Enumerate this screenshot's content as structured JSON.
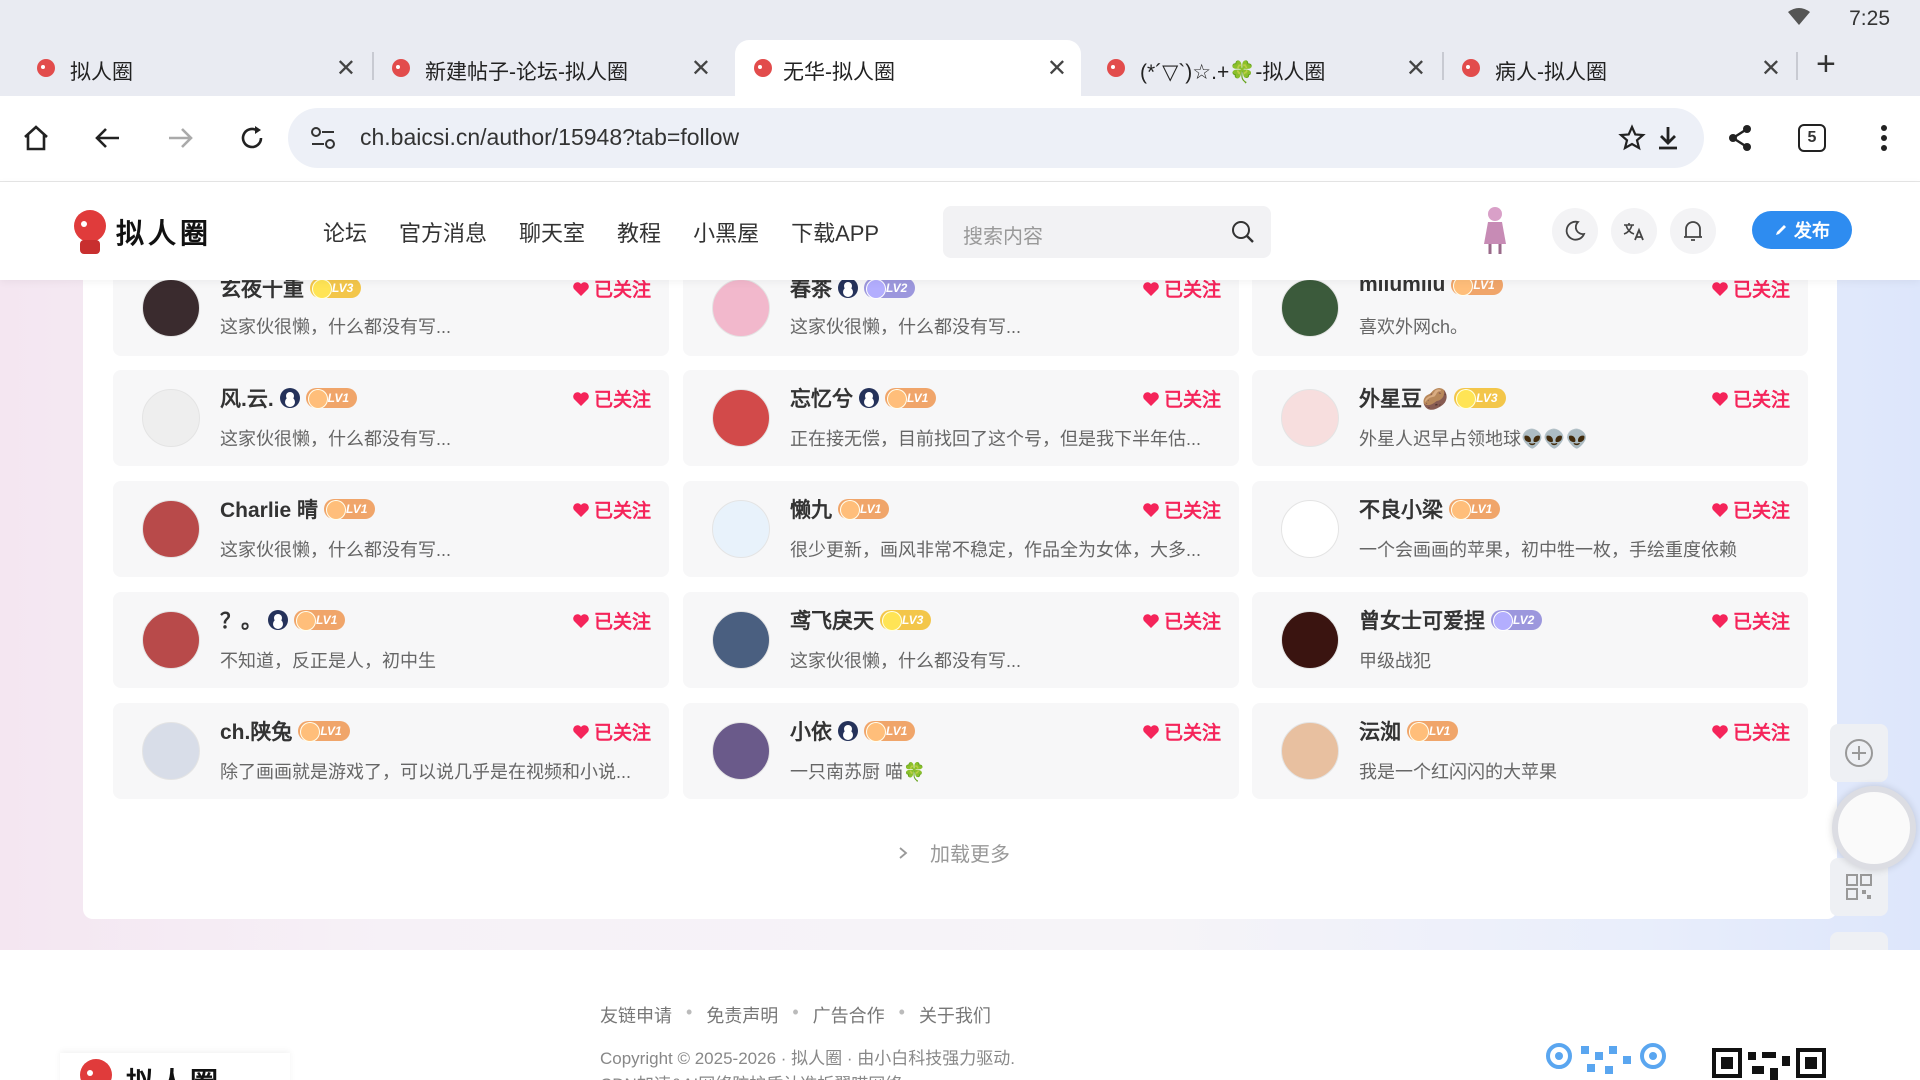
{
  "status": {
    "time": "7:25"
  },
  "tabs": [
    {
      "title": "拟人圈"
    },
    {
      "title": "新建帖子-论坛-拟人圈"
    },
    {
      "title": "无华-拟人圈"
    },
    {
      "title": "(*´▽`)☆.+🍀-拟人圈"
    },
    {
      "title": "病人-拟人圈"
    }
  ],
  "address": {
    "url": "ch.baicsi.cn/author/15948?tab=follow",
    "tab_count": "5"
  },
  "site": {
    "logo_text": "拟人圈",
    "nav": [
      "论坛",
      "官方消息",
      "聊天室",
      "教程",
      "小黑屋",
      "下载APP"
    ],
    "search_placeholder": "搜索内容",
    "publish_label": "发布"
  },
  "follow_label": "已关注",
  "users": [
    {
      "name": "玄夜十重",
      "level": "LV3",
      "verified": false,
      "bio": "这家伙很懒，什么都没有写..."
    },
    {
      "name": "春茶",
      "level": "LV2",
      "verified": true,
      "bio": "这家伙很懒，什么都没有写..."
    },
    {
      "name": "milumilu",
      "level": "LV1",
      "verified": false,
      "bio": "喜欢外网ch。"
    },
    {
      "name": "风.云.",
      "level": "LV1",
      "verified": true,
      "bio": "这家伙很懒，什么都没有写..."
    },
    {
      "name": "忘忆兮",
      "level": "LV1",
      "verified": true,
      "bio": "正在接无偿，目前找回了这个号，但是我下半年估..."
    },
    {
      "name": "外星豆🥔",
      "level": "LV3",
      "verified": false,
      "bio": "外星人迟早占领地球👽👽👽"
    },
    {
      "name": "Charlie 晴",
      "level": "LV1",
      "verified": false,
      "bio": "这家伙很懒，什么都没有写..."
    },
    {
      "name": "懒九",
      "level": "LV1",
      "verified": false,
      "bio": "很少更新，画风非常不稳定，作品全为女体，大多..."
    },
    {
      "name": "不良小梁",
      "level": "LV1",
      "verified": false,
      "bio": "一个会画画的苹果，初中牲一枚，手绘重度依赖"
    },
    {
      "name": "？。",
      "level": "LV1",
      "verified": true,
      "bio": "不知道，反正是人，初中生"
    },
    {
      "name": "鸢飞戾天",
      "level": "LV3",
      "verified": false,
      "bio": "这家伙很懒，什么都没有写..."
    },
    {
      "name": "曾女士可爱捏",
      "level": "LV2",
      "verified": false,
      "bio": "甲级战犯"
    },
    {
      "name": "ch.陕兔",
      "level": "LV1",
      "verified": false,
      "bio": "除了画画就是游戏了，可以说几乎是在视频和小说..."
    },
    {
      "name": "小依",
      "level": "LV1",
      "verified": true,
      "bio": "一只南苏厨 喵🍀"
    },
    {
      "name": "沄洳",
      "level": "LV1",
      "verified": false,
      "bio": "我是一个红闪闪的大苹果"
    }
  ],
  "load_more": "加载更多",
  "footer": {
    "links": [
      "友链申请",
      "免责声明",
      "广告合作",
      "关于我们"
    ],
    "copyright": "Copyright © 2025-2026 · 拟人圈 · 由小白科技强力驱动.",
    "cdn": "CDN加速&AI网络防护质认准折翼喵网络"
  },
  "colors": {
    "accent": "#2e8cf0",
    "follow": "#f5245a"
  }
}
